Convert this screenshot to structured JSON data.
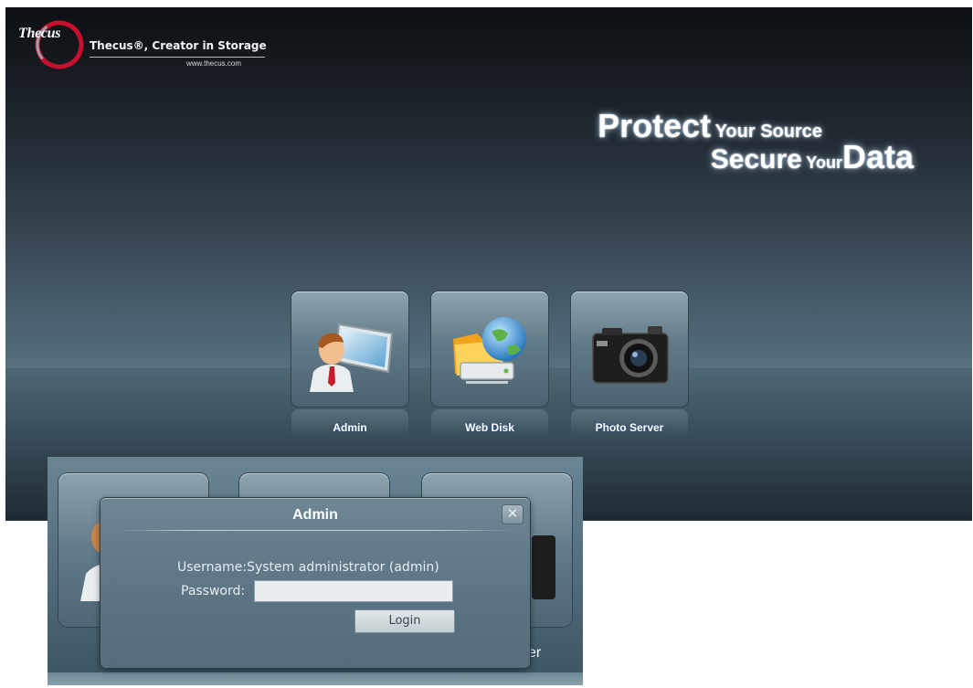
{
  "brand": {
    "badge": "Thecus",
    "tagline": "Thecus®, Creator in Storage",
    "url": "www.thecus.com"
  },
  "slogan": {
    "line1_big": "Protect",
    "line1_small": "Your Source",
    "line2_big1": "Secure",
    "line2_small": "Your",
    "line2_big2": "Data"
  },
  "apps": [
    {
      "label": "Admin",
      "icon": "admin-user-icon"
    },
    {
      "label": "Web Disk",
      "icon": "web-disk-icon"
    },
    {
      "label": "Photo Server",
      "icon": "camera-icon"
    }
  ],
  "inset": {
    "partial_label": "er"
  },
  "dialog": {
    "title": "Admin",
    "close_icon": "close-icon",
    "username_label": "Username:",
    "username_value": "System administrator (admin)",
    "password_label": "Password:",
    "password_value": "",
    "login_label": "Login"
  }
}
